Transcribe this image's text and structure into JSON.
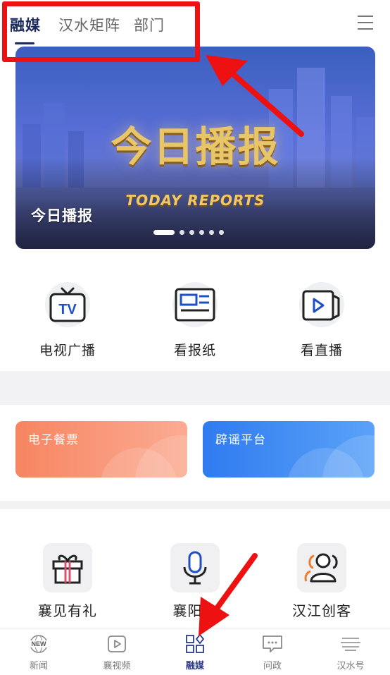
{
  "top_tabs": [
    {
      "label": "融媒",
      "active": true
    },
    {
      "label": "汉水矩阵",
      "active": false
    },
    {
      "label": "部门",
      "active": false
    }
  ],
  "banner": {
    "caption": "今日播报",
    "graphic_title": "今日播报",
    "graphic_subtitle": "TODAY REPORTS",
    "slide_count": 6,
    "active_slide": 1
  },
  "media": [
    {
      "label": "电视广播",
      "icon": "tv-icon"
    },
    {
      "label": "看报纸",
      "icon": "newspaper-icon"
    },
    {
      "label": "看直播",
      "icon": "live-play-icon"
    }
  ],
  "cards": [
    {
      "label": "电子餐票",
      "color_from": "#f78561",
      "color_to": "#fbab92"
    },
    {
      "label": "辟谣平台",
      "color_from": "#2f7bf0",
      "color_to": "#5aa2f8"
    }
  ],
  "services": [
    {
      "label": "襄见有礼",
      "icon": "gift-icon"
    },
    {
      "label": "襄阳发",
      "icon": "microphone-icon"
    },
    {
      "label": "汉江创客",
      "icon": "users-icon"
    }
  ],
  "bottom_nav": [
    {
      "label": "新闻",
      "icon": "news-icon",
      "active": false
    },
    {
      "label": "襄视频",
      "icon": "video-icon",
      "active": false
    },
    {
      "label": "融媒",
      "icon": "grid-icon",
      "active": true
    },
    {
      "label": "问政",
      "icon": "chat-icon",
      "active": false
    },
    {
      "label": "汉水号",
      "icon": "lines-icon",
      "active": false
    }
  ],
  "icons_text": {
    "news_badge": "NEW"
  },
  "colors": {
    "accent": "#1a2a5a",
    "annotation": "#ee1111",
    "nav_active": "#2b3a8a"
  }
}
